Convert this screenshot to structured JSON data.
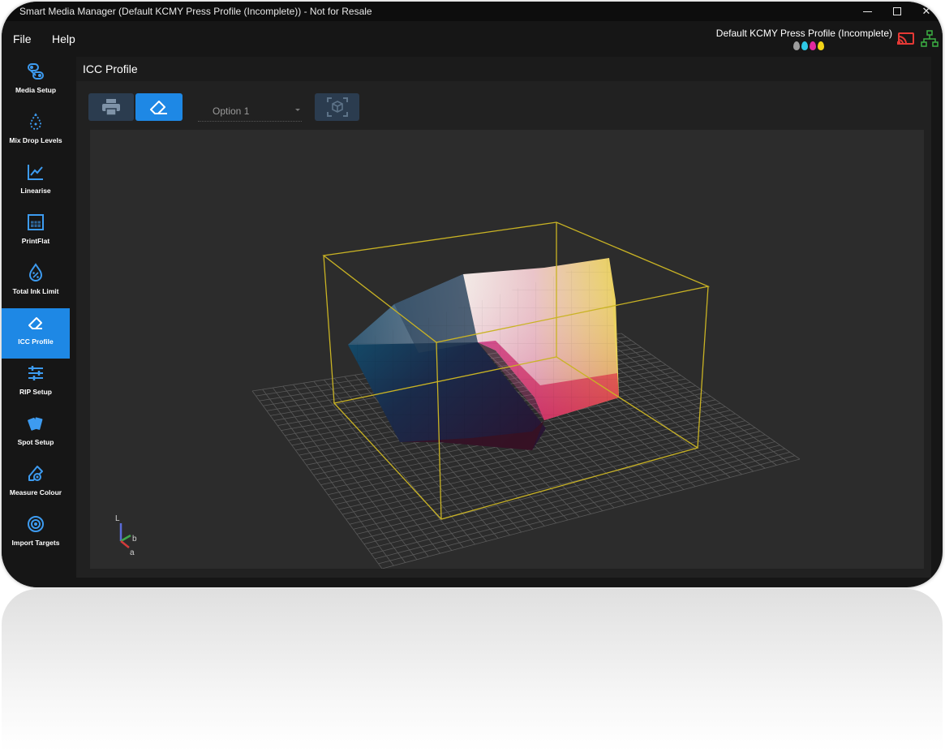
{
  "window": {
    "title": "Smart Media Manager (Default KCMY Press Profile (Incomplete)) - Not for Resale",
    "close_glyph": "✕"
  },
  "menu": {
    "items": [
      "File",
      "Help"
    ]
  },
  "status": {
    "profile_name": "Default KCMY Press Profile (Incomplete)",
    "ink_colors": [
      "#9e9e9e",
      "#2ec8e6",
      "#e0299f",
      "#f2d417"
    ],
    "cast_icon": "cast-icon",
    "cast_color": "#e53935",
    "network_icon": "network-icon",
    "network_color": "#3cb043"
  },
  "sidebar": {
    "active_color": "#1e88e5",
    "items": [
      {
        "label": "Media Setup",
        "icon": "media-setup-icon",
        "active": false
      },
      {
        "label": "Mix Drop Levels",
        "icon": "drop-levels-icon",
        "active": false
      },
      {
        "label": "Linearise",
        "icon": "line-chart-icon",
        "active": false
      },
      {
        "label": "PrintFlat",
        "icon": "printflat-icon",
        "active": false
      },
      {
        "label": "Total Ink Limit",
        "icon": "ink-limit-icon",
        "active": false
      },
      {
        "label": "ICC Profile",
        "icon": "eraser-icon",
        "active": true
      },
      {
        "label": "RIP Setup",
        "icon": "sliders-icon",
        "active": false
      },
      {
        "label": "Spot Setup",
        "icon": "swatch-icon",
        "active": false
      },
      {
        "label": "Measure Colour",
        "icon": "measure-icon",
        "active": false
      },
      {
        "label": "Import Targets",
        "icon": "target-icon",
        "active": false
      }
    ]
  },
  "panel": {
    "title": "ICC Profile",
    "toolbar": {
      "print_icon": "printer-icon",
      "icc_icon": "eraser-icon",
      "select_value": "Option 1",
      "reset_view_icon": "cube-view-icon"
    }
  },
  "gamut_view": {
    "axes": {
      "l": "L",
      "b": "b",
      "a": "a"
    },
    "bounding_box_color": "#c9b324",
    "grid_color": "#5a5a5a"
  }
}
